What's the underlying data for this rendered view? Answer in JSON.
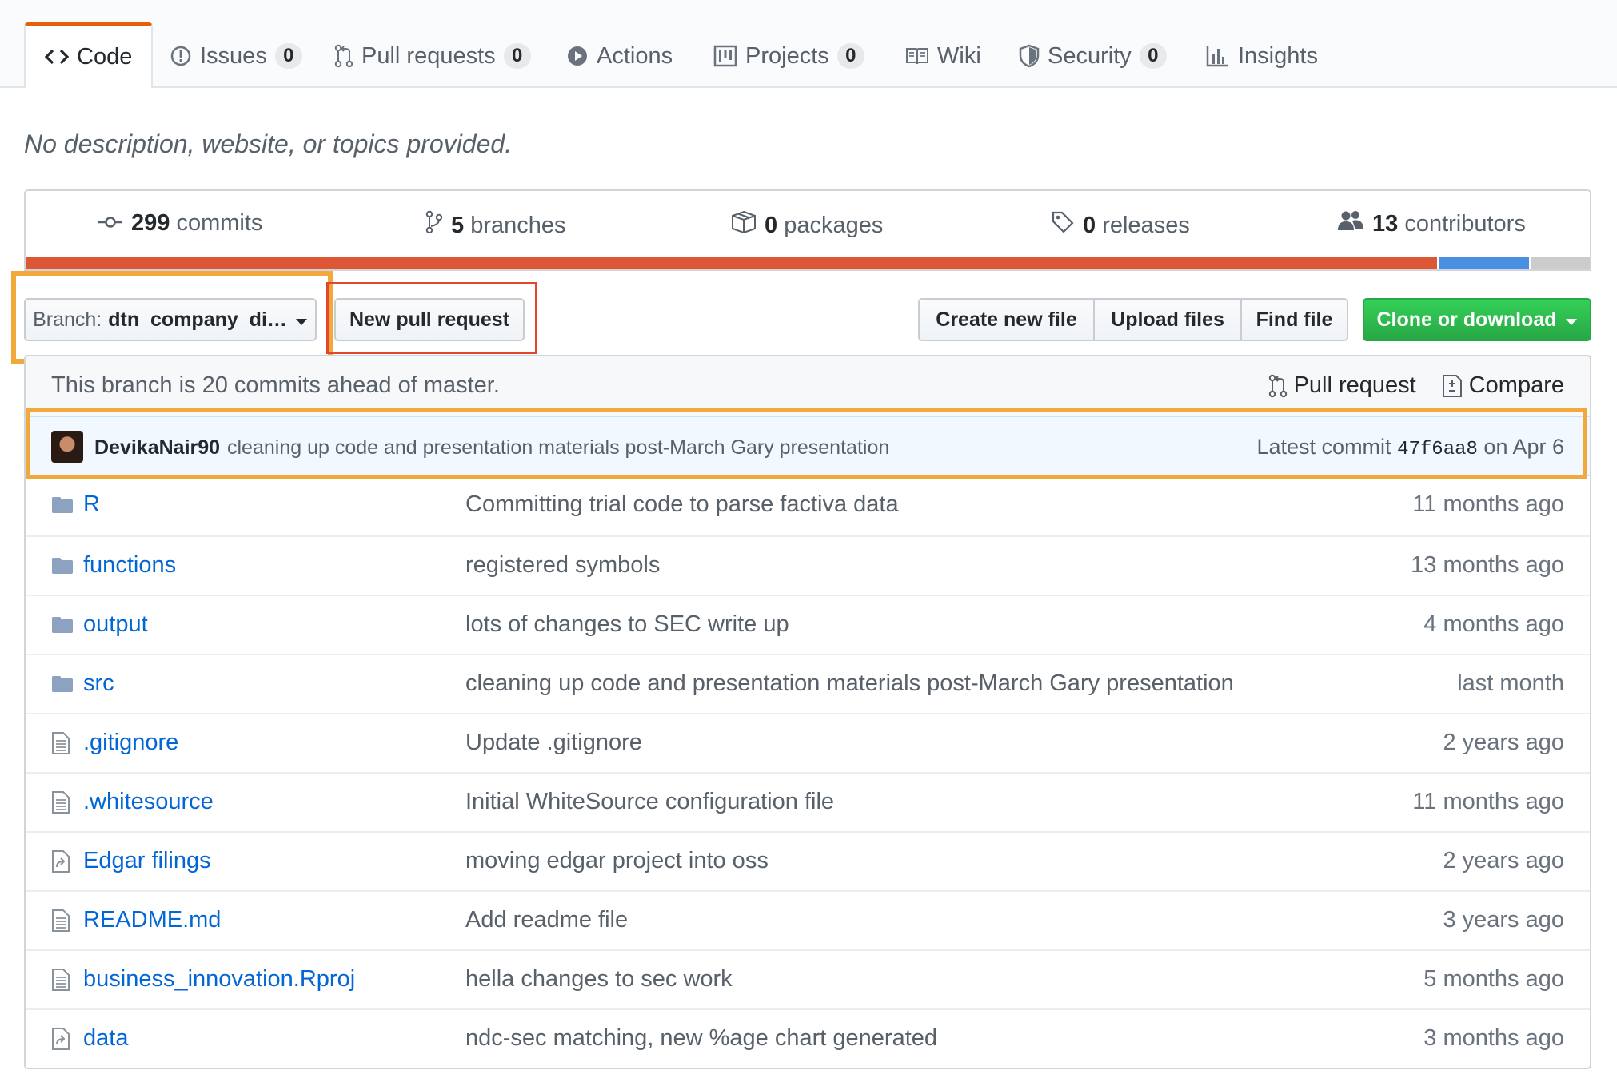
{
  "tabs": [
    {
      "label": "Code",
      "icon": "code-icon",
      "selected": true
    },
    {
      "label": "Issues",
      "icon": "issue-icon",
      "count": "0"
    },
    {
      "label": "Pull requests",
      "icon": "git-pull-request-icon",
      "count": "0"
    },
    {
      "label": "Actions",
      "icon": "play-icon"
    },
    {
      "label": "Projects",
      "icon": "project-icon",
      "count": "0"
    },
    {
      "label": "Wiki",
      "icon": "book-icon"
    },
    {
      "label": "Security",
      "icon": "shield-icon",
      "count": "0"
    },
    {
      "label": "Insights",
      "icon": "graph-icon"
    }
  ],
  "description": "No description, website, or topics provided.",
  "summary": {
    "commits": {
      "count": "299",
      "label": "commits"
    },
    "branches": {
      "count": "5",
      "label": "branches"
    },
    "packages": {
      "count": "0",
      "label": "packages"
    },
    "releases": {
      "count": "0",
      "label": "releases"
    },
    "contributors": {
      "count": "13",
      "label": "contributors"
    }
  },
  "languages": [
    {
      "color": "#dd5635",
      "share": 0.904
    },
    {
      "color": "#4a90e2",
      "share": 0.058
    },
    {
      "color": "#cccccc",
      "share": 0.038
    }
  ],
  "branch_button": {
    "prefix": "Branch:",
    "name": "dtn_company_di…"
  },
  "new_pr_button": "New pull request",
  "file_buttons": {
    "create": "Create new file",
    "upload": "Upload files",
    "find": "Find file",
    "clone": "Clone or download"
  },
  "branch_info": {
    "message": "This branch is 20 commits ahead of master.",
    "pull_request": "Pull request",
    "compare": "Compare"
  },
  "latest_commit": {
    "author": "DevikaNair90",
    "message": "cleaning up code and presentation materials post-March Gary presentation",
    "label": "Latest commit",
    "sha": "47f6aa8",
    "date": "on Apr 6"
  },
  "files": [
    {
      "name": "R",
      "type": "folder",
      "message": "Committing trial code to parse factiva data",
      "age": "11 months ago"
    },
    {
      "name": "functions",
      "type": "folder",
      "message": "registered symbols",
      "age": "13 months ago"
    },
    {
      "name": "output",
      "type": "folder",
      "message": "lots of changes to SEC write up",
      "age": "4 months ago"
    },
    {
      "name": "src",
      "type": "folder",
      "message": "cleaning up code and presentation materials post-March Gary presentation",
      "age": "last month"
    },
    {
      "name": ".gitignore",
      "type": "file",
      "message": "Update .gitignore",
      "age": "2 years ago"
    },
    {
      "name": ".whitesource",
      "type": "file",
      "message": "Initial WhiteSource configuration file",
      "age": "11 months ago"
    },
    {
      "name": "Edgar filings",
      "type": "symlink",
      "message": "moving edgar project into oss",
      "age": "2 years ago"
    },
    {
      "name": "README.md",
      "type": "file",
      "message": "Add readme file",
      "age": "3 years ago"
    },
    {
      "name": "business_innovation.Rproj",
      "type": "file",
      "message": "hella changes to sec work",
      "age": "5 months ago"
    },
    {
      "name": "data",
      "type": "symlink",
      "message": "ndc-sec matching, new %age chart generated",
      "age": "3 months ago"
    }
  ],
  "colors": {
    "accent_tab": "#e36209",
    "link": "#0366d6",
    "green_button": "#28a745",
    "highlight_orange": "#f2a93b",
    "highlight_red": "#e3452d"
  }
}
